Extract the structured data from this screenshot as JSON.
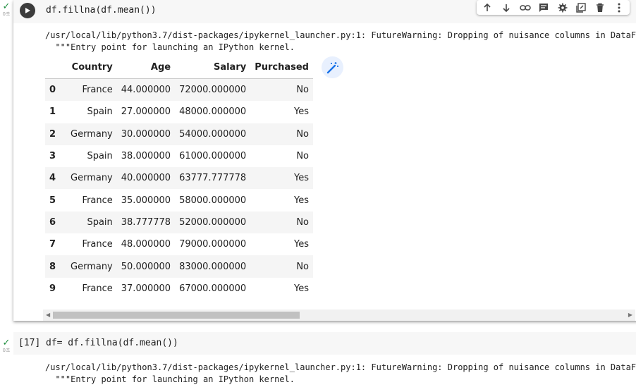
{
  "cell1": {
    "status": {
      "icon": "check-icon",
      "time": "0초"
    },
    "code": "df.fillna(df.mean())",
    "warning_line1": "/usr/local/lib/python3.7/dist-packages/ipykernel_launcher.py:1: FutureWarning: Dropping of nuisance columns in DataFrame",
    "warning_line2": "  \"\"\"Entry point for launching an IPython kernel.",
    "table": {
      "headers": [
        "",
        "Country",
        "Age",
        "Salary",
        "Purchased"
      ],
      "rows": [
        [
          "0",
          "France",
          "44.000000",
          "72000.000000",
          "No"
        ],
        [
          "1",
          "Spain",
          "27.000000",
          "48000.000000",
          "Yes"
        ],
        [
          "2",
          "Germany",
          "30.000000",
          "54000.000000",
          "No"
        ],
        [
          "3",
          "Spain",
          "38.000000",
          "61000.000000",
          "No"
        ],
        [
          "4",
          "Germany",
          "40.000000",
          "63777.777778",
          "Yes"
        ],
        [
          "5",
          "France",
          "35.000000",
          "58000.000000",
          "Yes"
        ],
        [
          "6",
          "Spain",
          "38.777778",
          "52000.000000",
          "No"
        ],
        [
          "7",
          "France",
          "48.000000",
          "79000.000000",
          "Yes"
        ],
        [
          "8",
          "Germany",
          "50.000000",
          "83000.000000",
          "No"
        ],
        [
          "9",
          "France",
          "37.000000",
          "67000.000000",
          "Yes"
        ]
      ]
    },
    "toolbar_icons": [
      "arrow-up-icon",
      "arrow-down-icon",
      "link-icon",
      "comment-icon",
      "gear-icon",
      "mirror-cell-icon",
      "delete-icon",
      "more-vert-icon"
    ]
  },
  "cell2": {
    "status": {
      "icon": "check-icon",
      "time": "0초"
    },
    "execution_count": "[17]",
    "code": "df= df.fillna(df.mean())",
    "warning_line1": "/usr/local/lib/python3.7/dist-packages/ipykernel_launcher.py:1: FutureWarning: Dropping of nuisance columns in DataFrame",
    "warning_line2": "  \"\"\"Entry point for launching an IPython kernel."
  },
  "colors": {
    "accent": "#1a73e8",
    "success": "#1e8e3e",
    "cell_bg": "#f7f7f7",
    "row_stripe": "#f5f5f5"
  }
}
